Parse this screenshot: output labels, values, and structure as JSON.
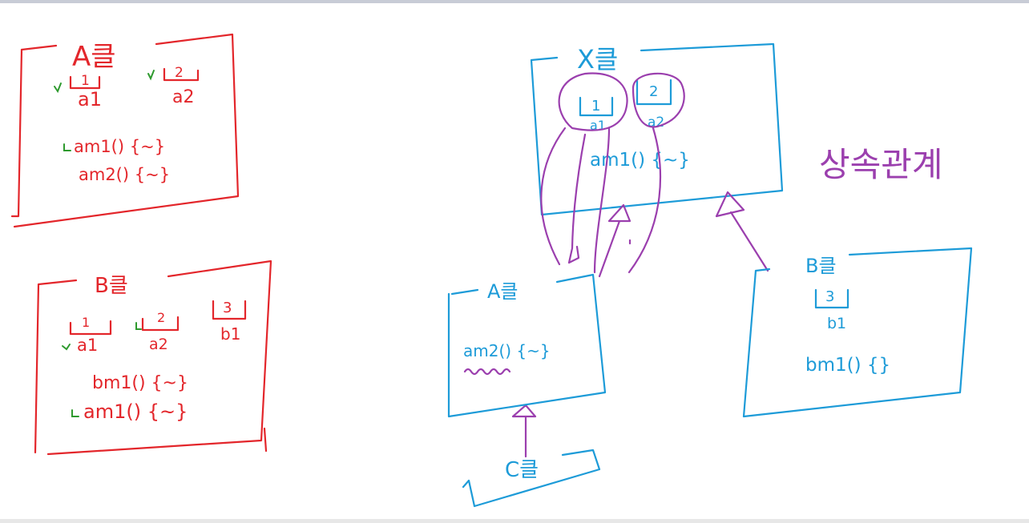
{
  "left_panel": {
    "class_a": {
      "title": "A클",
      "fields": [
        "1",
        "2"
      ],
      "field_names": [
        "a1",
        "a2"
      ],
      "methods": [
        "am1() {~}",
        "am2() {~}"
      ]
    },
    "class_b": {
      "title": "B클",
      "fields": [
        "1",
        "2",
        "3"
      ],
      "field_names": [
        "a1",
        "a2",
        "b1"
      ],
      "methods": [
        "bm1() {~}",
        "am1() {~}"
      ]
    }
  },
  "right_panel": {
    "class_x": {
      "title": "X클",
      "fields": [
        "1",
        "2"
      ],
      "field_names": [
        "a1",
        "a2"
      ],
      "methods": [
        "am1() {~}"
      ]
    },
    "class_a": {
      "title": "A클",
      "methods": [
        "am2() {~}"
      ]
    },
    "class_b": {
      "title": "B클",
      "fields": [
        "3"
      ],
      "field_names": [
        "b1"
      ],
      "methods": [
        "bm1() {}"
      ]
    },
    "class_c": {
      "title": "C클"
    },
    "relation_label": "상속관계"
  },
  "colors": {
    "left_ink": "#e3262b",
    "check_ink": "#2e9a2e",
    "right_ink": "#1d9bd8",
    "relation_ink": "#9b3fae"
  }
}
